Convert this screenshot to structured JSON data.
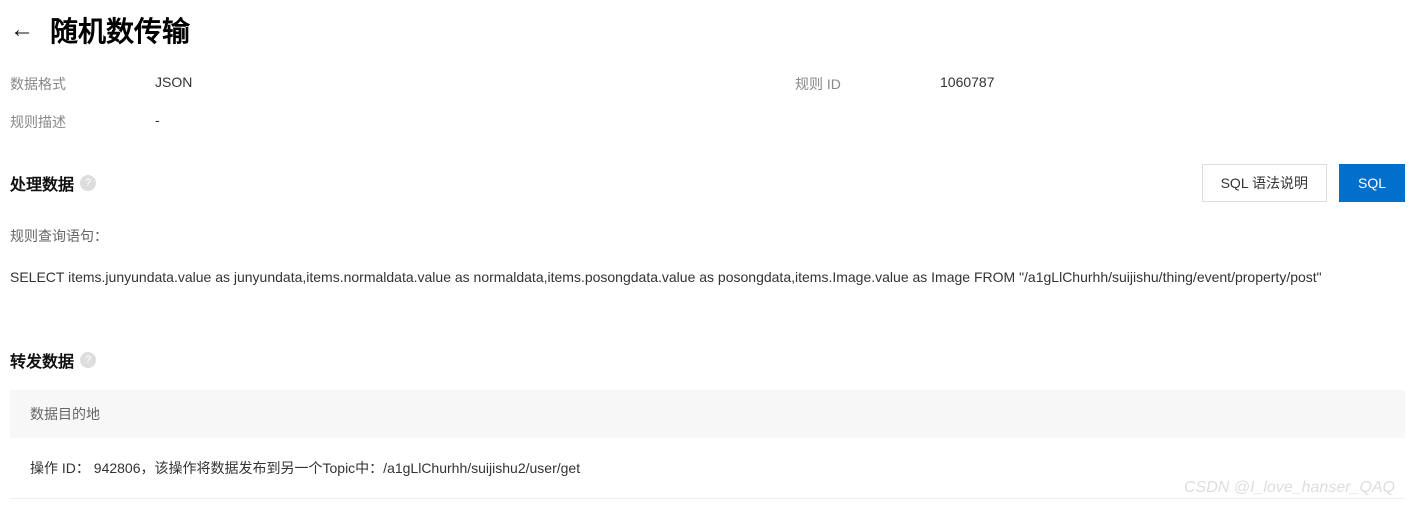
{
  "header": {
    "title": "随机数传输"
  },
  "meta": {
    "format_label": "数据格式",
    "format_value": "JSON",
    "rule_id_label": "规则 ID",
    "rule_id_value": "1060787",
    "desc_label": "规则描述",
    "desc_value": "-"
  },
  "process": {
    "title": "处理数据",
    "sql_help_btn": "SQL 语法说明",
    "sql_btn": "SQL",
    "query_label": "规则查询语句：",
    "sql": "SELECT items.junyundata.value as junyundata,items.normaldata.value as normaldata,items.posongdata.value as posongdata,items.Image.value as Image FROM \"/a1gLlChurhh/suijishu/thing/event/property/post\""
  },
  "forward": {
    "title": "转发数据",
    "dest_header": "数据目的地",
    "operation": "操作 ID： 942806，该操作将数据发布到另一个Topic中：/a1gLlChurhh/suijishu2/user/get"
  },
  "watermark": "CSDN @I_love_hanser_QAQ"
}
